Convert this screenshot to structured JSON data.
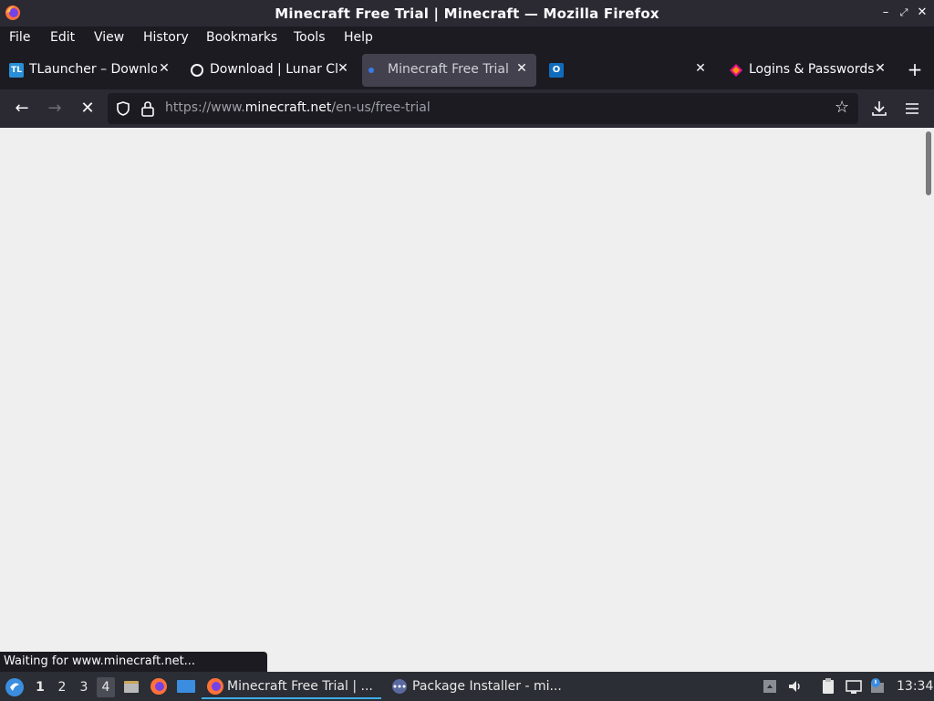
{
  "window": {
    "title": "Minecraft Free Trial | Minecraft — Mozilla Firefox"
  },
  "menu": [
    {
      "label": "File"
    },
    {
      "label": "Edit"
    },
    {
      "label": "View"
    },
    {
      "label": "History"
    },
    {
      "label": "Bookmarks"
    },
    {
      "label": "Tools"
    },
    {
      "label": "Help"
    }
  ],
  "tabs": [
    {
      "label": "TLauncher – Download",
      "favicon": "tlauncher-icon",
      "active": false
    },
    {
      "label": "Download | Lunar Client",
      "favicon": "lunar-icon",
      "active": false
    },
    {
      "label": "Minecraft Free Trial | Minecraft",
      "favicon": "loading-icon",
      "active": true
    },
    {
      "label": "",
      "favicon": "outlook-icon",
      "active": false
    },
    {
      "label": "Logins & Passwords",
      "favicon": "lockwise-icon",
      "active": false
    }
  ],
  "url": {
    "prefix": "https://www.",
    "host": "minecraft.net",
    "path": "/en-us/free-trial"
  },
  "status": {
    "text": "Waiting for www.minecraft.net..."
  },
  "taskbar": {
    "workspaces": [
      "1",
      "2",
      "3",
      "4"
    ],
    "active_workspace": "4",
    "tasks": [
      {
        "label": "Minecraft Free Trial | ...",
        "icon": "firefox-icon",
        "active": true
      },
      {
        "label": "Package Installer - mi...",
        "icon": "package-icon",
        "active": false
      }
    ],
    "clock": "13:34"
  },
  "colors": {
    "accent": "#3daee9",
    "chrome_dark": "#1c1b22",
    "toolbar": "#2b2a33",
    "active_tab": "#42414d",
    "page_bg": "#efefef"
  }
}
